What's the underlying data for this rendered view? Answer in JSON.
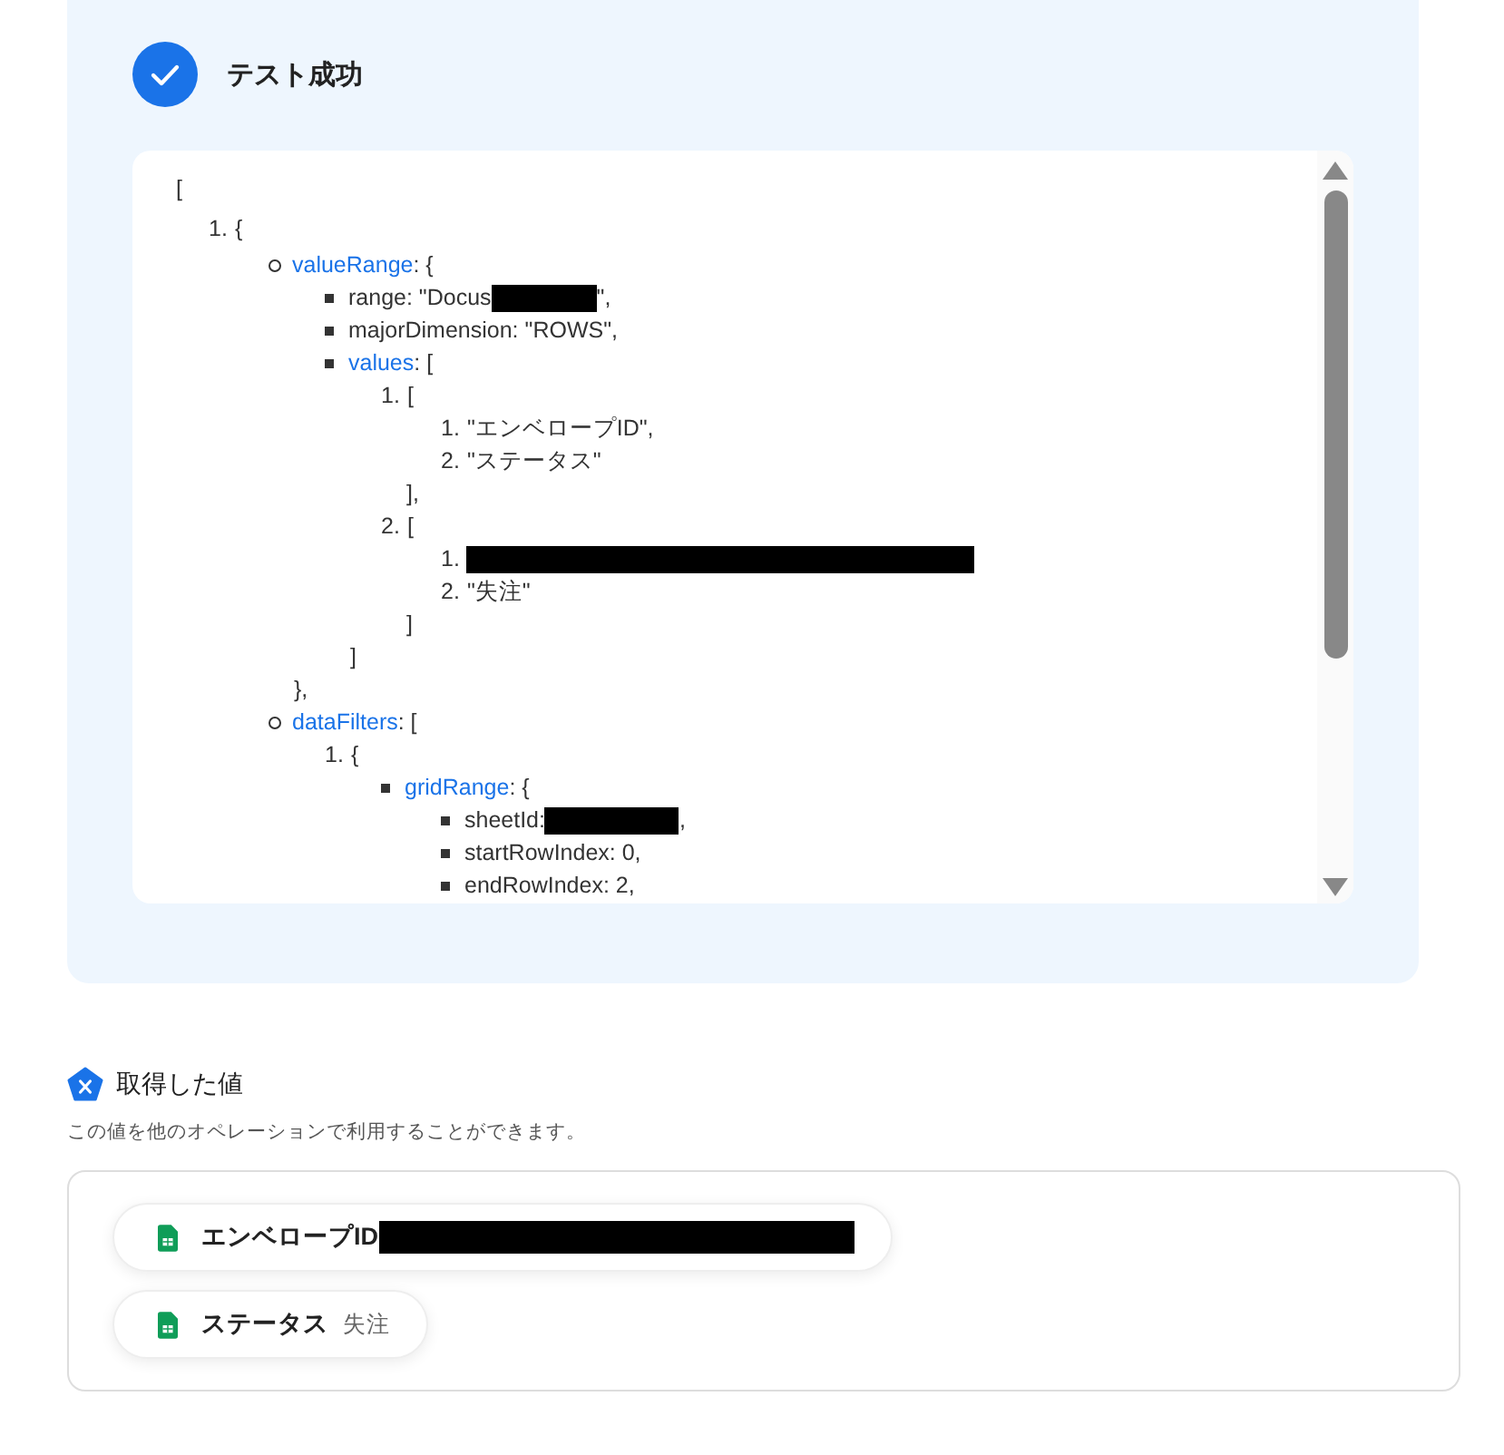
{
  "test_result": {
    "title": "テスト成功",
    "output": [
      {
        "parts": [
          {
            "kind": "text",
            "text": "["
          }
        ],
        "children": [
          {
            "kind": "numbered",
            "number": "1.",
            "parts": [
              {
                "kind": "text",
                "text": "{"
              }
            ],
            "children": [
              {
                "kind": "circle",
                "parts": [
                  {
                    "kind": "key",
                    "text": "valueRange"
                  },
                  {
                    "kind": "text",
                    "text": ": {"
                  }
                ],
                "close": "},",
                "children": [
                  {
                    "kind": "square",
                    "parts": [
                      {
                        "kind": "text",
                        "text": "range: \"Docus"
                      },
                      {
                        "kind": "redaction"
                      },
                      {
                        "kind": "text",
                        "text": "\","
                      }
                    ]
                  },
                  {
                    "kind": "square",
                    "parts": [
                      {
                        "kind": "text",
                        "text": "majorDimension: \"ROWS\","
                      }
                    ]
                  },
                  {
                    "kind": "square",
                    "parts": [
                      {
                        "kind": "key",
                        "text": "values"
                      },
                      {
                        "kind": "text",
                        "text": ": ["
                      }
                    ],
                    "close": "]",
                    "children": [
                      {
                        "kind": "numbered",
                        "number": "1.",
                        "parts": [
                          {
                            "kind": "text",
                            "text": "["
                          }
                        ],
                        "close": "],",
                        "children": [
                          {
                            "kind": "numbered",
                            "number": "1.",
                            "parts": [
                              {
                                "kind": "text",
                                "text": "\"エンベロープID\","
                              }
                            ]
                          },
                          {
                            "kind": "numbered",
                            "number": "2.",
                            "parts": [
                              {
                                "kind": "text",
                                "text": "\"ステータス\""
                              }
                            ]
                          }
                        ]
                      },
                      {
                        "kind": "numbered",
                        "number": "2.",
                        "parts": [
                          {
                            "kind": "text",
                            "text": "["
                          }
                        ],
                        "close": "]",
                        "children": [
                          {
                            "kind": "numbered",
                            "number": "1.",
                            "parts": [
                              {
                                "kind": "redaction"
                              }
                            ]
                          },
                          {
                            "kind": "numbered",
                            "number": "2.",
                            "parts": [
                              {
                                "kind": "text",
                                "text": "\"失注\""
                              }
                            ]
                          }
                        ]
                      }
                    ]
                  }
                ]
              },
              {
                "kind": "circle",
                "parts": [
                  {
                    "kind": "key",
                    "text": "dataFilters"
                  },
                  {
                    "kind": "text",
                    "text": ": ["
                  }
                ],
                "children": [
                  {
                    "kind": "numbered",
                    "number": "1.",
                    "parts": [
                      {
                        "kind": "text",
                        "text": "{"
                      }
                    ],
                    "children": [
                      {
                        "kind": "square",
                        "parts": [
                          {
                            "kind": "key",
                            "text": "gridRange"
                          },
                          {
                            "kind": "text",
                            "text": ": {"
                          }
                        ],
                        "children": [
                          {
                            "kind": "square",
                            "parts": [
                              {
                                "kind": "text",
                                "text": "sheetId:"
                              },
                              {
                                "kind": "redaction"
                              },
                              {
                                "kind": "text",
                                "text": ","
                              }
                            ]
                          },
                          {
                            "kind": "square",
                            "parts": [
                              {
                                "kind": "text",
                                "text": "startRowIndex: 0,"
                              }
                            ]
                          },
                          {
                            "kind": "square",
                            "parts": [
                              {
                                "kind": "text",
                                "text": "endRowIndex: 2,"
                              }
                            ]
                          }
                        ]
                      }
                    ]
                  }
                ]
              }
            ]
          }
        ]
      }
    ]
  },
  "values_section": {
    "title": "取得した値",
    "description": "この値を他のオペレーションで利用することができます。",
    "values": [
      {
        "label": "エンベロープID",
        "redacted": true
      },
      {
        "label": "ステータス",
        "redacted": false,
        "value": "失注"
      }
    ]
  }
}
